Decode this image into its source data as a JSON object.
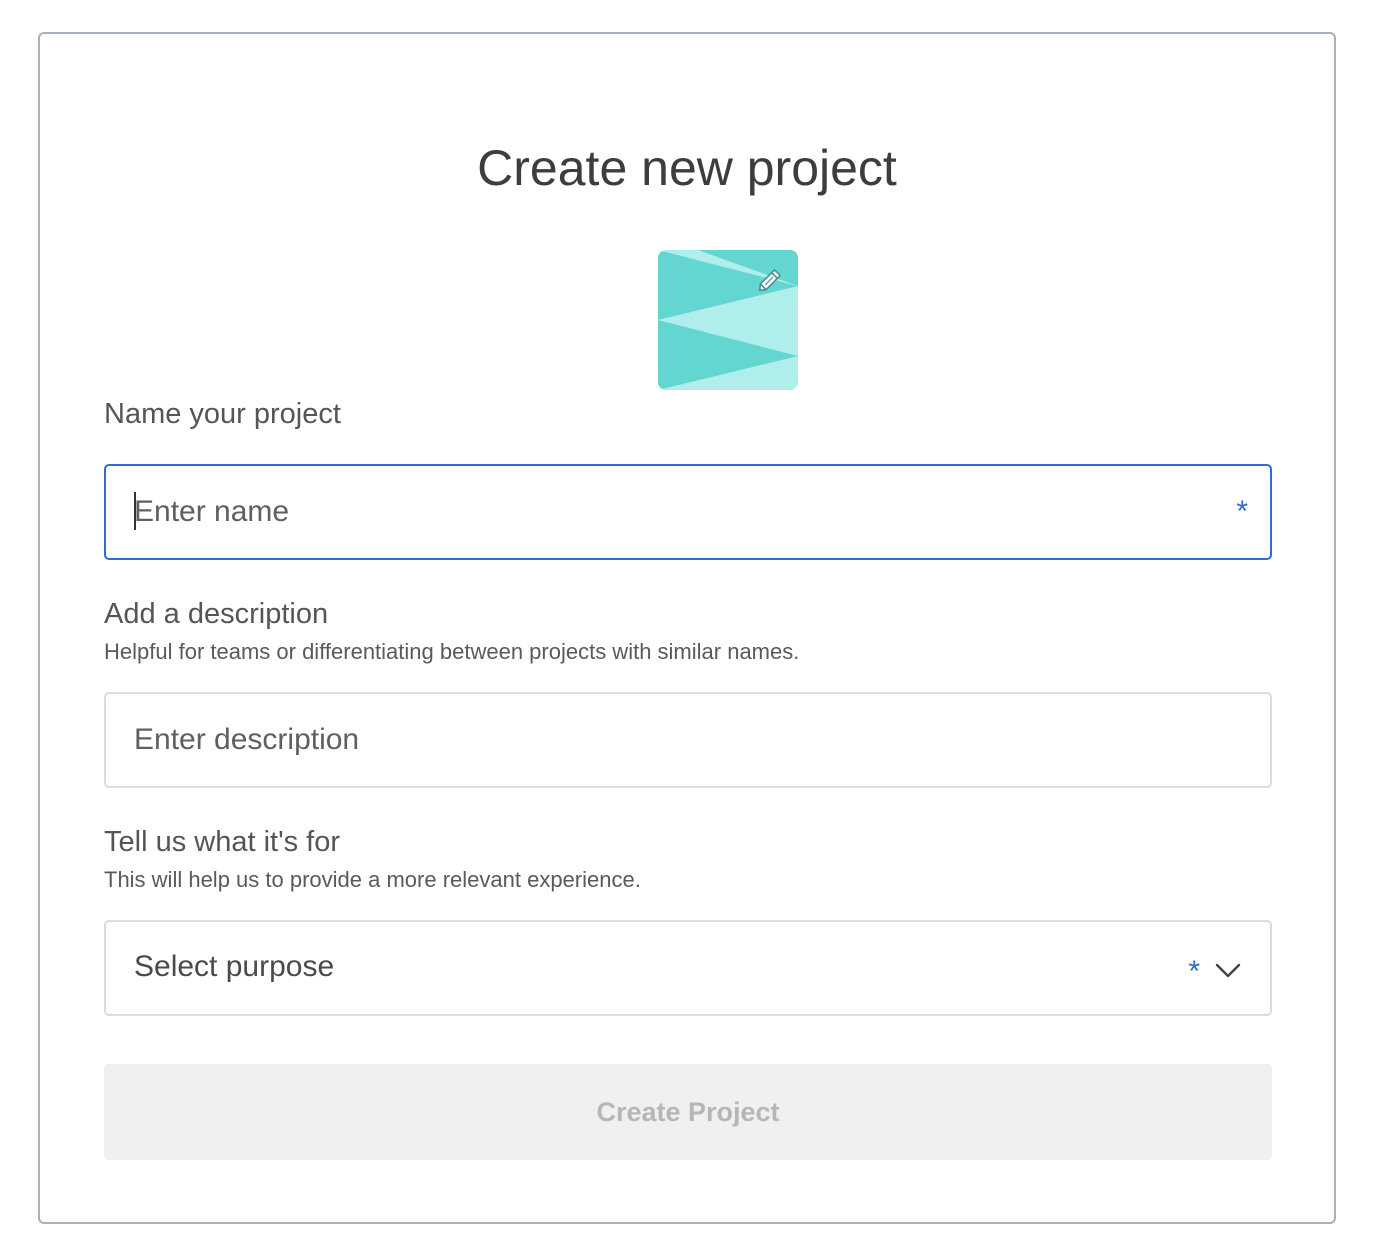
{
  "page_title": "Create new project",
  "thumbnail": {
    "colors": {
      "dark": "#64d6d2",
      "light": "#b0eeeb"
    },
    "edit_icon": "pencil-icon"
  },
  "name_section": {
    "label": "Name your project",
    "placeholder": "Enter name",
    "value": "",
    "required_marker": "*"
  },
  "description_section": {
    "label": "Add a description",
    "helper": "Helpful for teams or differentiating between projects with similar names.",
    "placeholder": "Enter description",
    "value": ""
  },
  "purpose_section": {
    "label": "Tell us what it's for",
    "helper": "This will help us to provide a more relevant experience.",
    "selected": "Select purpose",
    "required_marker": "*",
    "icon": "chevron-down-icon"
  },
  "submit": {
    "label": "Create Project",
    "disabled": true
  },
  "colors": {
    "accent": "#2f6ad8",
    "card_border": "#a9b1bf",
    "disabled_bg": "#f0f0f0",
    "disabled_text": "#b6b6b6"
  }
}
